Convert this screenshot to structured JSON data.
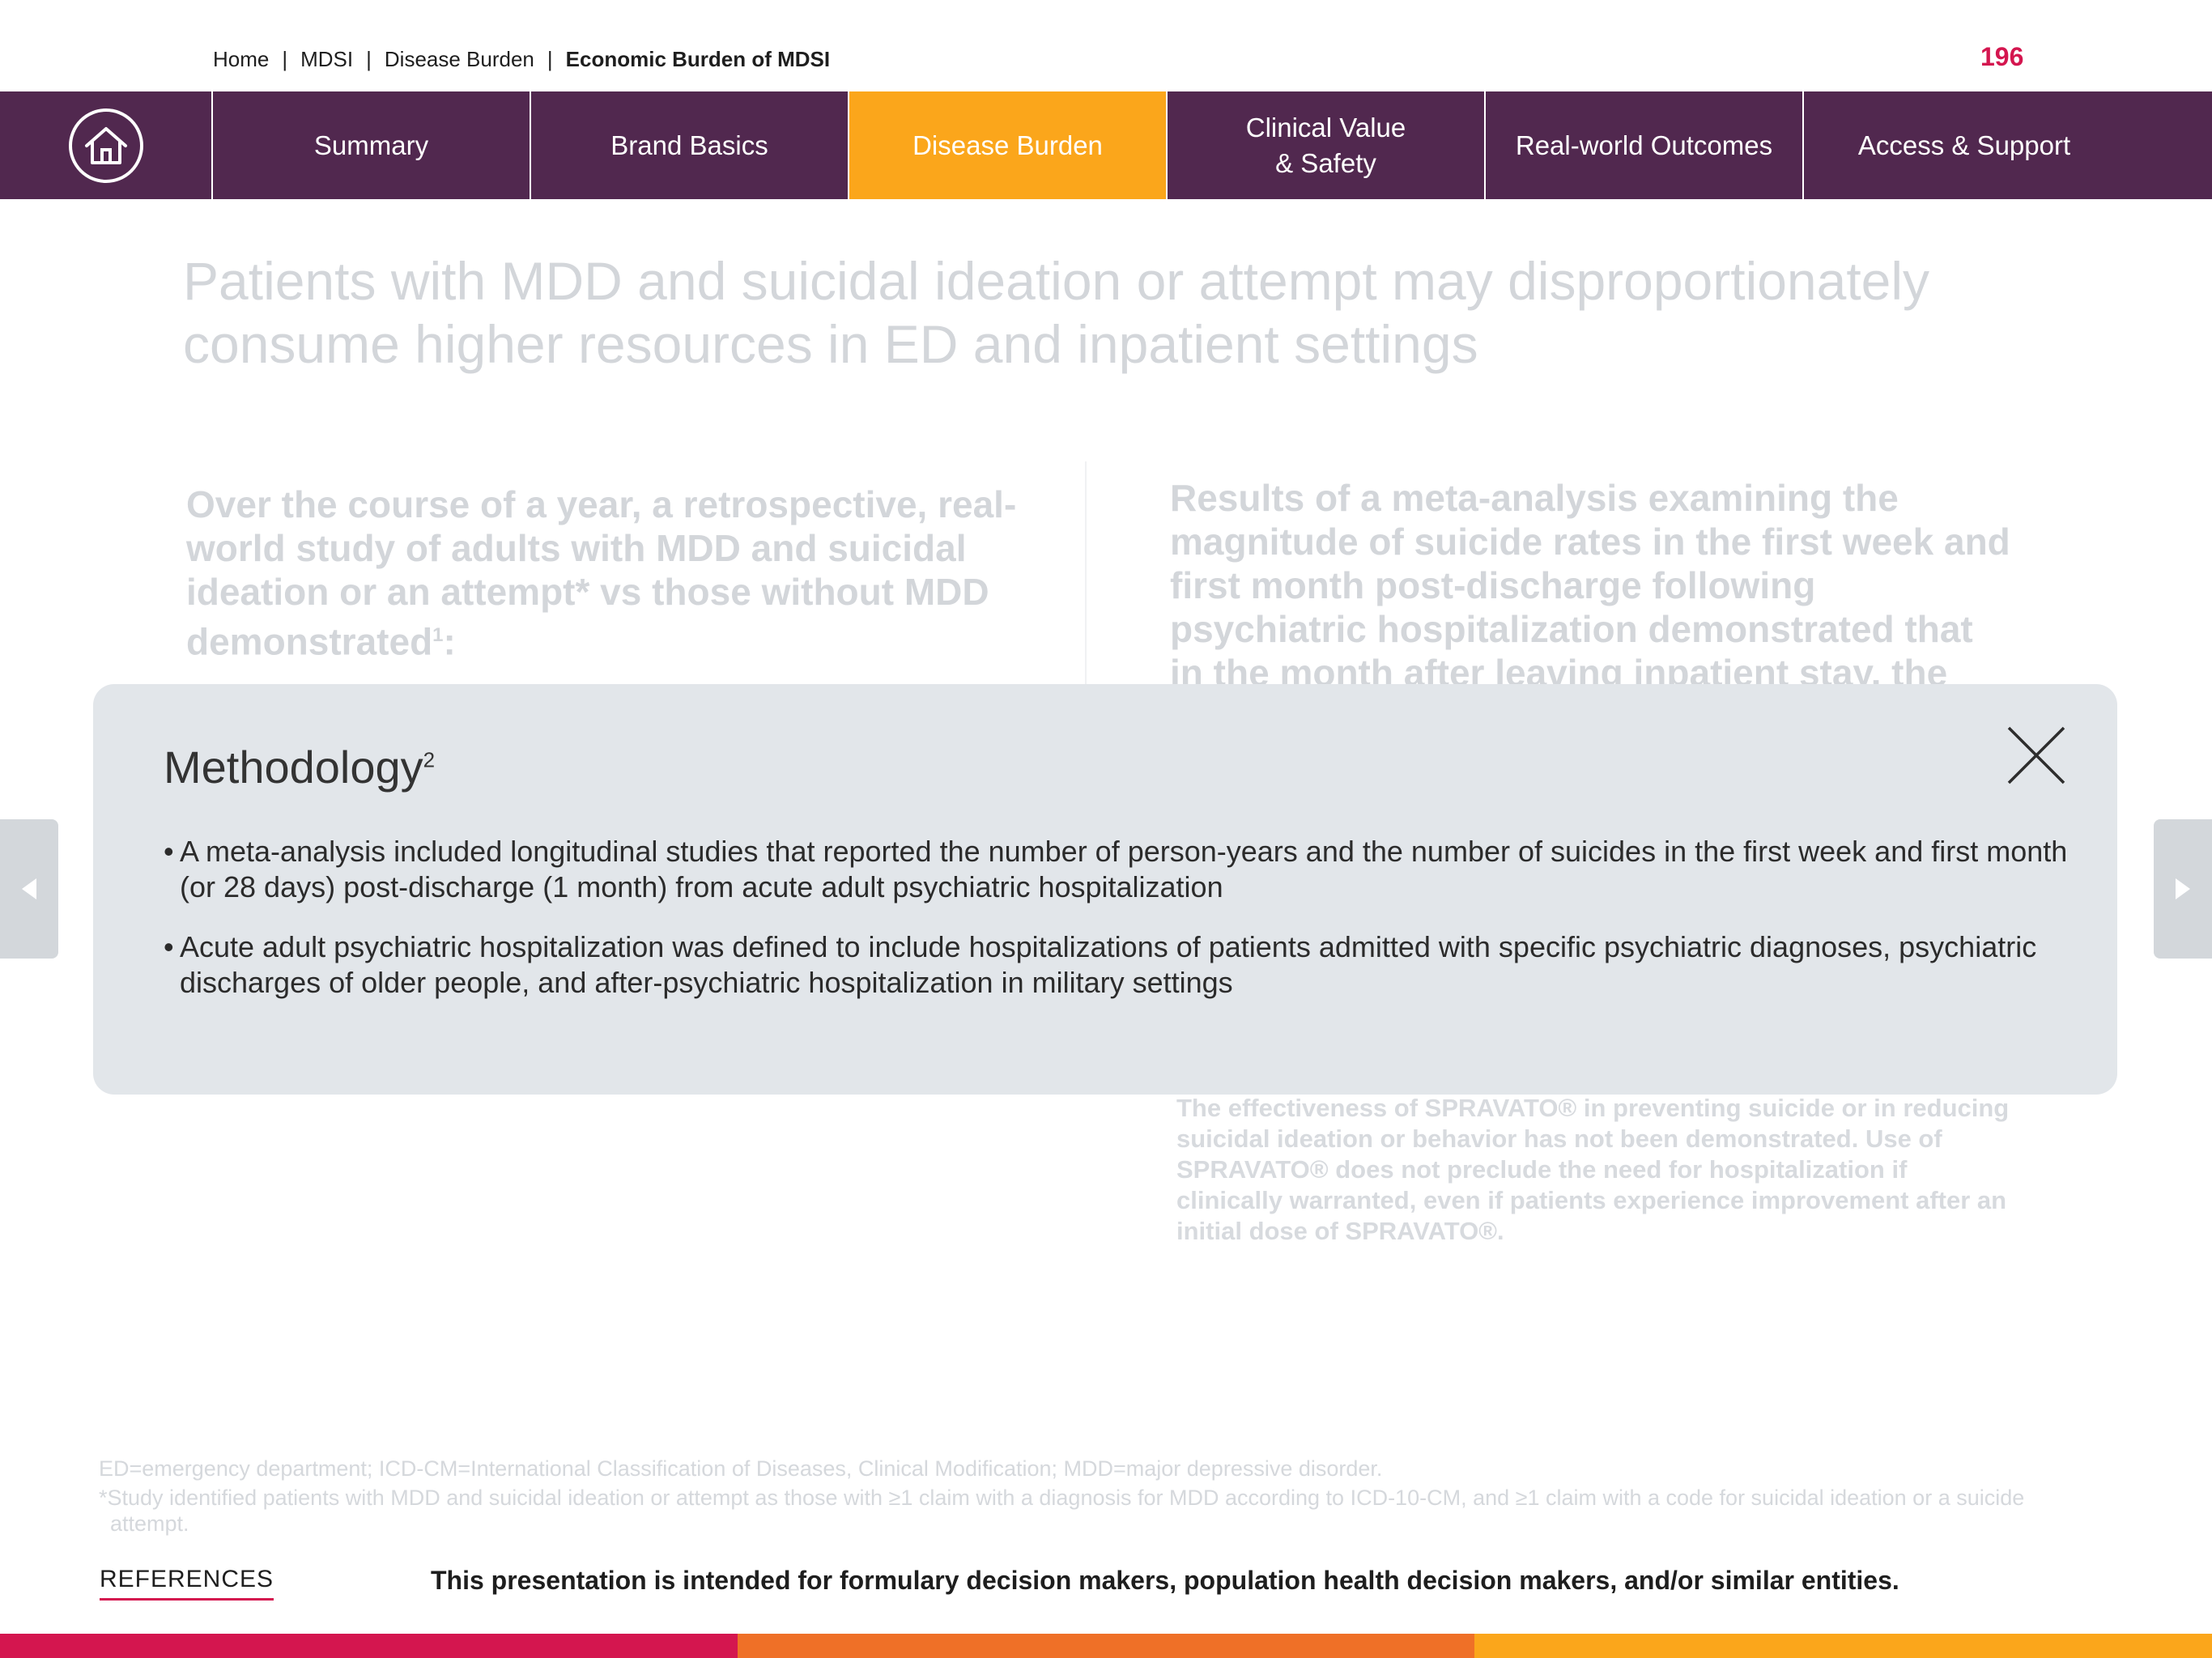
{
  "breadcrumb": {
    "items": [
      "Home",
      "MDSI",
      "Disease Burden"
    ],
    "separator": "|",
    "current": "Economic Burden of MDSI"
  },
  "page_number": "196",
  "nav": {
    "home_icon": "house-icon",
    "tabs": [
      {
        "label": "Summary",
        "active": false
      },
      {
        "label": "Brand Basics",
        "active": false
      },
      {
        "label": "Disease Burden",
        "active": true
      },
      {
        "label": "Clinical Value\n& Safety",
        "active": false
      },
      {
        "label": "Real-world Outcomes",
        "active": false
      },
      {
        "label": "Access & Support",
        "active": false
      }
    ],
    "colors": {
      "background": "#51284f",
      "active": "#fba61b"
    }
  },
  "background": {
    "title": "Patients with MDD and suicidal ideation or attempt may disproportionately consume higher resources in ED and inpatient settings",
    "left_card": {
      "text_pre": "Over the course of a year, a retrospective, real-world study of adults with ",
      "text_bold": "MDD and suicidal ideation or an attempt* vs those without MDD demonstrated",
      "sup": "1",
      "text_post": ":"
    },
    "right_card": {
      "text_pre": "Results of a meta-analysis examining the magnitude of suicide rates in the first week and first month post-discharge following psychiatric hospitalization demonstrated that ",
      "text_bold": "in the month after leaving inpatient stay, the suicide death"
    },
    "safety_note": "The effectiveness of SPRAVATO® in preventing suicide or in reducing suicidal ideation or behavior has not been demonstrated. Use of SPRAVATO® does not preclude the need for hospitalization if clinically warranted, even if patients experience improvement after an initial dose of SPRAVATO®."
  },
  "modal": {
    "title": "Methodology",
    "title_sup": "2",
    "close_icon": "close-x-icon",
    "bullets": [
      "A meta-analysis included longitudinal studies that reported the number of person-years and the number of suicides in the first week and first month (or 28 days) post-discharge (1 month) from acute adult psychiatric hospitalization",
      "Acute adult psychiatric hospitalization was defined to include hospitalizations of patients admitted with specific psychiatric diagnoses, psychiatric discharges of older people, and after-psychiatric hospitalization in military settings"
    ],
    "bullet_char": "•"
  },
  "arrows": {
    "left_icon": "arrow-left-icon",
    "right_icon": "arrow-right-icon"
  },
  "footnotes": {
    "abbreviations": "ED=emergency department; ICD-CM=International Classification of Diseases, Clinical Modification; MDD=major depressive disorder.",
    "study_note": "*Study identified patients with MDD and suicidal ideation or attempt as those with ≥1 claim with a diagnosis for MDD according to ICD-10-CM, and ≥1 claim with a code for suicidal ideation or a suicide attempt."
  },
  "references_label": "REFERENCES",
  "disclaimer": "This presentation is intended for formulary decision makers, population health decision makers, and/or similar entities.",
  "color_bar": [
    "#d4164f",
    "#ef7027",
    "#fba61b"
  ]
}
